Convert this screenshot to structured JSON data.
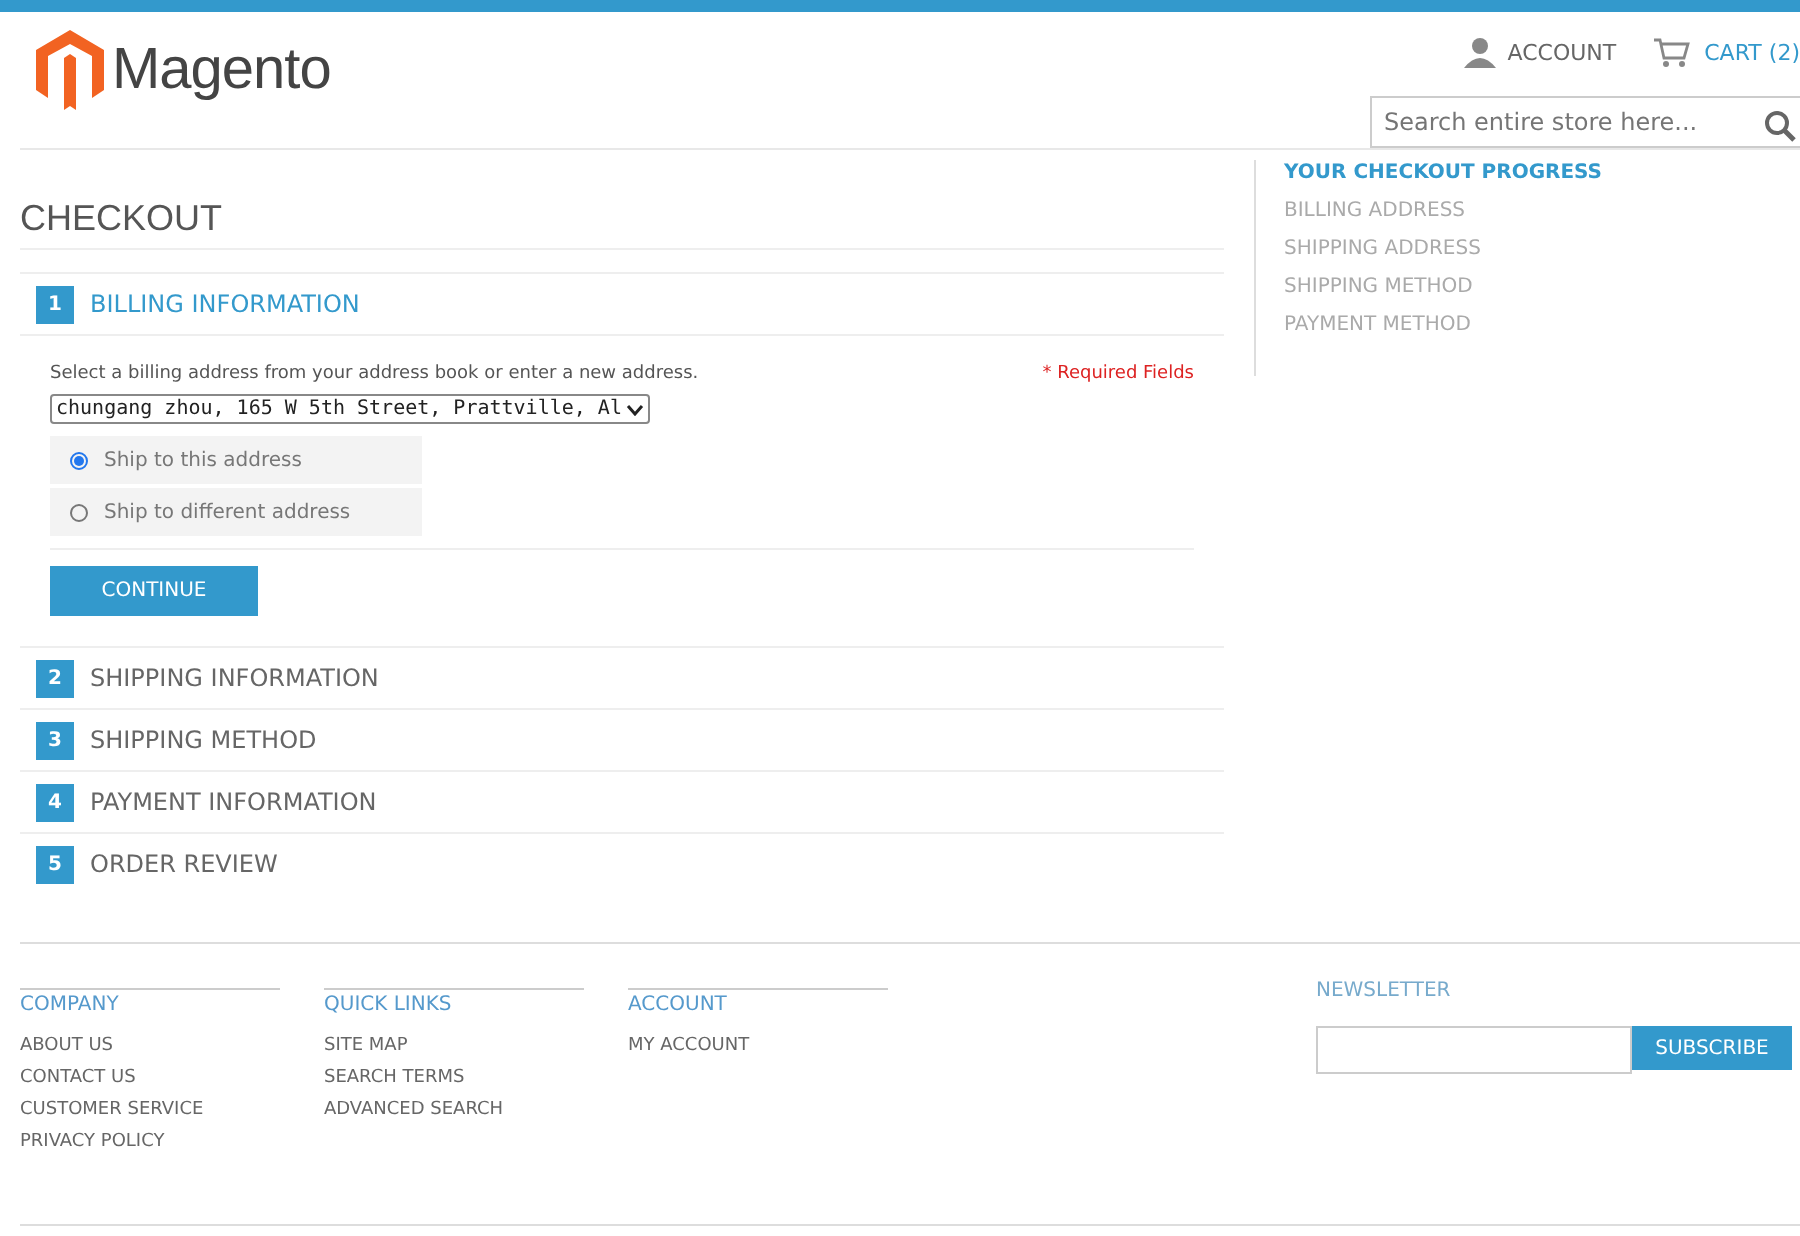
{
  "header": {
    "logo": "Magento",
    "account": "ACCOUNT",
    "cart": "CART",
    "cart_count": "(2)",
    "search": {
      "placeholder": "Search entire store here..."
    }
  },
  "page_title": "CHECKOUT",
  "steps": [
    {
      "number": "1",
      "title": "BILLING INFORMATION",
      "active": true
    },
    {
      "number": "2",
      "title": "SHIPPING INFORMATION",
      "active": false
    },
    {
      "number": "3",
      "title": "SHIPPING METHOD",
      "active": false
    },
    {
      "number": "4",
      "title": "PAYMENT INFORMATION",
      "active": false
    },
    {
      "number": "5",
      "title": "ORDER REVIEW",
      "active": false
    }
  ],
  "billing": {
    "instruction": "Select a billing address from your address book or enter a new address.",
    "required_note": "* Required Fields",
    "address": "chungang zhou, 165 W 5th Street, Prattville, Al",
    "options": [
      {
        "label": "Ship to this address",
        "selected": true
      },
      {
        "label": "Ship to different address",
        "selected": false
      }
    ],
    "continue": "CONTINUE"
  },
  "progress": {
    "title": "YOUR CHECKOUT PROGRESS",
    "items": [
      "BILLING ADDRESS",
      "SHIPPING ADDRESS",
      "SHIPPING METHOD",
      "PAYMENT METHOD"
    ]
  },
  "footer": {
    "columns": [
      {
        "title": "COMPANY",
        "links": [
          "ABOUT US",
          "CONTACT US",
          "CUSTOMER SERVICE",
          "PRIVACY POLICY"
        ]
      },
      {
        "title": "QUICK LINKS",
        "links": [
          "SITE MAP",
          "SEARCH TERMS",
          "ADVANCED SEARCH"
        ]
      },
      {
        "title": "ACCOUNT",
        "links": [
          "MY ACCOUNT"
        ]
      }
    ],
    "newsletter": {
      "title": "NEWSLETTER",
      "button": "SUBSCRIBE"
    }
  }
}
